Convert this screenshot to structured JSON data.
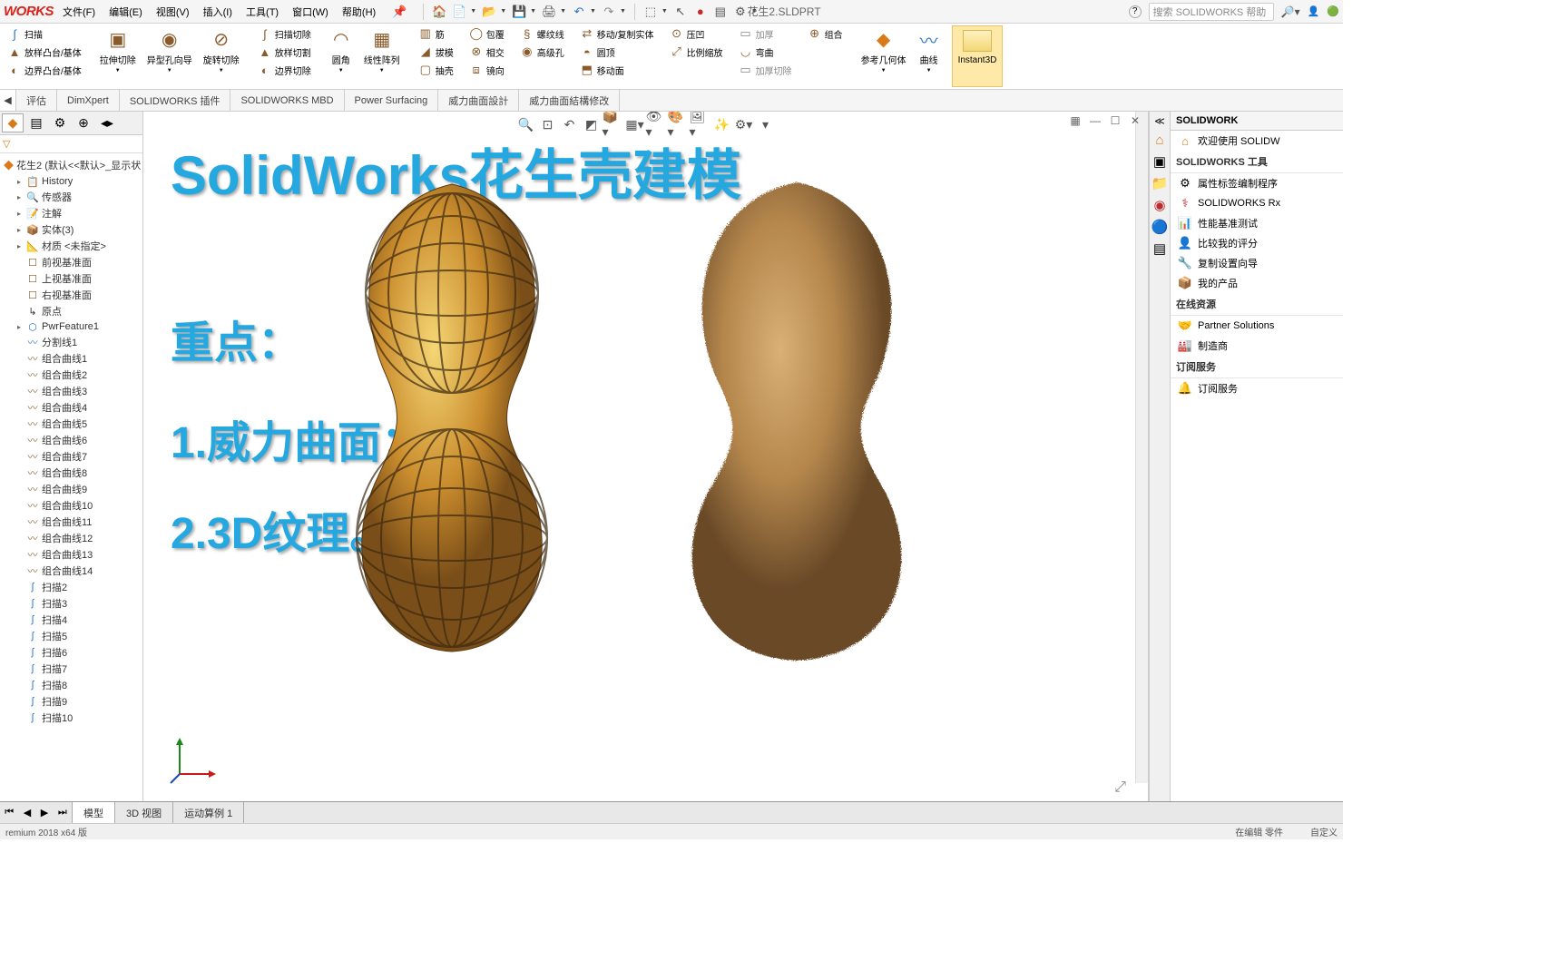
{
  "app": {
    "logo": "WORKS",
    "title": "花生2.SLDPRT"
  },
  "menu": {
    "file": "文件(F)",
    "edit": "编辑(E)",
    "view": "视图(V)",
    "insert": "插入(I)",
    "tools": "工具(T)",
    "window": "窗口(W)",
    "help": "帮助(H)"
  },
  "search": {
    "placeholder": "搜索 SOLIDWORKS 帮助",
    "icon_help": "?"
  },
  "ribbon": {
    "sweep": "扫描",
    "loft": "放样凸台/基体",
    "boundary": "边界凸台/基体",
    "extcut": "拉伸切除",
    "holewiz": "异型孔向导",
    "revcut": "旋转切除",
    "sweepcut": "扫描切除",
    "loftcut": "放样切割",
    "boundcut": "边界切除",
    "fillet": "圆角",
    "linpat": "线性阵列",
    "rib": "筋",
    "draft": "拔模",
    "shell": "抽壳",
    "wrap": "包覆",
    "intersect": "相交",
    "mirror": "镜向",
    "heliline": "螺纹线",
    "movecopy": "移动/复制实体",
    "compress": "压凹",
    "advhole": "高级孔",
    "dome": "圆顶",
    "moveface": "移动面",
    "proporscale": "比例缩放",
    "thick": "加厚",
    "thickcut": "加厚切除",
    "bend": "弯曲",
    "combine": "组合",
    "refgeo": "参考几何体",
    "curve": "曲线",
    "instant": "Instant3D"
  },
  "tabs": {
    "feature": "评估",
    "dimxpert": "DimXpert",
    "plugin": "SOLIDWORKS 插件",
    "mbd": "SOLIDWORKS MBD",
    "ps": "Power Surfacing",
    "pd": "威力曲面設計",
    "pp": "威力曲面結構修改"
  },
  "tree": {
    "title": "花生2  (默认<<默认>_显示状",
    "items": [
      {
        "icon": "📋",
        "label": "History",
        "cls": "blue"
      },
      {
        "icon": "🔍",
        "label": "传感器",
        "cls": ""
      },
      {
        "icon": "📝",
        "label": "注解",
        "cls": ""
      },
      {
        "icon": "📦",
        "label": "实体(3)",
        "cls": "blue"
      },
      {
        "icon": "📐",
        "label": "材质 <未指定>",
        "cls": ""
      },
      {
        "icon": "☐",
        "label": "前视基准面",
        "cls": "brown"
      },
      {
        "icon": "☐",
        "label": "上视基准面",
        "cls": "brown"
      },
      {
        "icon": "☐",
        "label": "右视基准面",
        "cls": "brown"
      },
      {
        "icon": "↳",
        "label": "原点",
        "cls": ""
      },
      {
        "icon": "⬡",
        "label": "PwrFeature1",
        "cls": "blue"
      },
      {
        "icon": "〰",
        "label": "分割线1",
        "cls": "blue"
      },
      {
        "icon": "〰",
        "label": "组合曲线1",
        "cls": "brown"
      },
      {
        "icon": "〰",
        "label": "组合曲线2",
        "cls": "brown"
      },
      {
        "icon": "〰",
        "label": "组合曲线3",
        "cls": "brown"
      },
      {
        "icon": "〰",
        "label": "组合曲线4",
        "cls": "brown"
      },
      {
        "icon": "〰",
        "label": "组合曲线5",
        "cls": "brown"
      },
      {
        "icon": "〰",
        "label": "组合曲线6",
        "cls": "brown"
      },
      {
        "icon": "〰",
        "label": "组合曲线7",
        "cls": "brown"
      },
      {
        "icon": "〰",
        "label": "组合曲线8",
        "cls": "brown"
      },
      {
        "icon": "〰",
        "label": "组合曲线9",
        "cls": "brown"
      },
      {
        "icon": "〰",
        "label": "组合曲线10",
        "cls": "brown"
      },
      {
        "icon": "〰",
        "label": "组合曲线11",
        "cls": "brown"
      },
      {
        "icon": "〰",
        "label": "组合曲线12",
        "cls": "brown"
      },
      {
        "icon": "〰",
        "label": "组合曲线13",
        "cls": "brown"
      },
      {
        "icon": "〰",
        "label": "组合曲线14",
        "cls": "brown"
      },
      {
        "icon": "∫",
        "label": "扫描2",
        "cls": "blue"
      },
      {
        "icon": "∫",
        "label": "扫描3",
        "cls": "blue"
      },
      {
        "icon": "∫",
        "label": "扫描4",
        "cls": "blue"
      },
      {
        "icon": "∫",
        "label": "扫描5",
        "cls": "blue"
      },
      {
        "icon": "∫",
        "label": "扫描6",
        "cls": "blue"
      },
      {
        "icon": "∫",
        "label": "扫描7",
        "cls": "blue"
      },
      {
        "icon": "∫",
        "label": "扫描8",
        "cls": "blue"
      },
      {
        "icon": "∫",
        "label": "扫描9",
        "cls": "blue"
      },
      {
        "icon": "∫",
        "label": "扫描10",
        "cls": "blue"
      }
    ]
  },
  "overlay": {
    "t1": "SolidWorks花生壳建模",
    "t2": "重点：",
    "t3": "1.威力曲面；",
    "t4": "2.3D纹理。"
  },
  "taskpanel": {
    "header_text": "SOLIDWORK",
    "welcome": "欢迎使用  SOLIDW",
    "tools_title": "SOLIDWORKS 工具",
    "tools": [
      {
        "icon": "⚙",
        "label": "属性标签编制程序"
      },
      {
        "icon": "⚕",
        "label": "SOLIDWORKS Rx",
        "cls": "red"
      },
      {
        "icon": "📊",
        "label": "性能基准测试"
      },
      {
        "icon": "👤",
        "label": "比较我的评分"
      },
      {
        "icon": "🔧",
        "label": "复制设置向导"
      },
      {
        "icon": "📦",
        "label": "我的产品"
      }
    ],
    "online_title": "在线资源",
    "online": [
      {
        "icon": "🤝",
        "label": "Partner Solutions"
      },
      {
        "icon": "🏭",
        "label": "制造商"
      }
    ],
    "sub_title": "订阅服务",
    "sub": [
      {
        "icon": "🔔",
        "label": "订阅服务"
      }
    ]
  },
  "bottom_tabs": {
    "model": "模型",
    "view3d": "3D 视图",
    "motion": "运动算例 1"
  },
  "status": {
    "left": "remium 2018 x64 版",
    "mid": "在编辑 零件",
    "right": "自定义"
  }
}
